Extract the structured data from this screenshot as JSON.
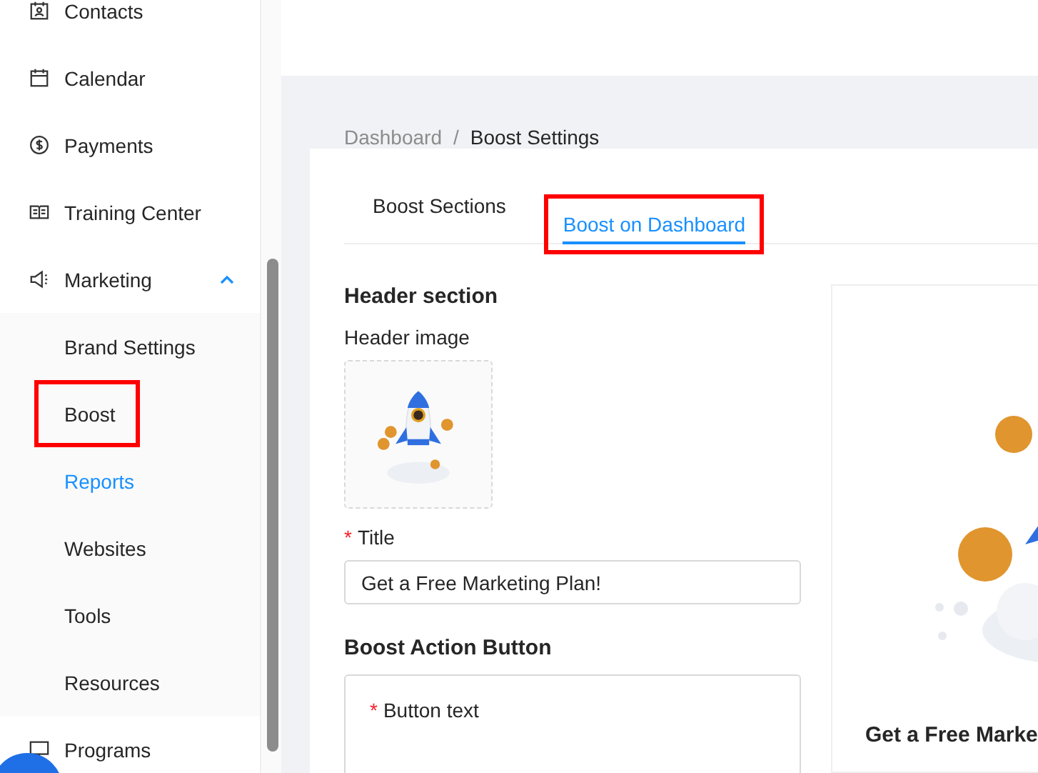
{
  "sidebar": {
    "items": [
      {
        "label": "Contacts",
        "selected": false
      },
      {
        "label": "Calendar",
        "selected": false
      },
      {
        "label": "Payments",
        "selected": false
      },
      {
        "label": "Training Center",
        "selected": false
      },
      {
        "label": "Marketing",
        "selected": false,
        "expanded": true,
        "children": [
          {
            "label": "Brand Settings",
            "selected": false,
            "highlighted": false
          },
          {
            "label": "Boost",
            "selected": false,
            "highlighted": true
          },
          {
            "label": "Reports",
            "selected": true,
            "highlighted": false
          },
          {
            "label": "Websites",
            "selected": false,
            "highlighted": false
          },
          {
            "label": "Tools",
            "selected": false,
            "highlighted": false
          },
          {
            "label": "Resources",
            "selected": false,
            "highlighted": false
          }
        ]
      },
      {
        "label": "Programs",
        "selected": false
      }
    ]
  },
  "breadcrumb": {
    "items": [
      "Dashboard",
      "Boost Settings"
    ],
    "separator": "/"
  },
  "tabs": [
    {
      "label": "Boost Sections",
      "selected": false,
      "highlighted": false
    },
    {
      "label": "Boost on Dashboard",
      "selected": true,
      "highlighted": true
    }
  ],
  "form": {
    "header_heading": "Header section",
    "image_label": "Header image",
    "title_mark": "*",
    "title_label": "Title",
    "title_value": "Get a Free Marketing Plan!",
    "action_heading": "Boost Action Button",
    "button_text_mark": "*",
    "button_text_label": "Button text"
  },
  "preview": {
    "title": "Get a Free Marke"
  }
}
